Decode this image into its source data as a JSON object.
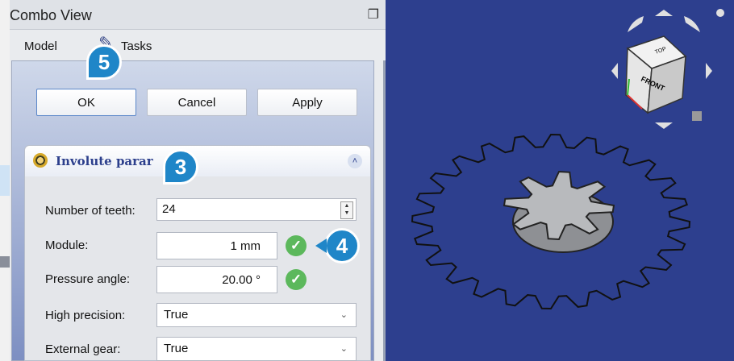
{
  "window": {
    "title": "Combo View"
  },
  "tabs": [
    {
      "label": "Model"
    },
    {
      "label": "Tasks"
    }
  ],
  "buttons": {
    "ok": "OK",
    "cancel": "Cancel",
    "apply": "Apply"
  },
  "section": {
    "title": "Involute parar"
  },
  "fields": {
    "number_of_teeth": {
      "label": "Number of teeth:",
      "value": "24"
    },
    "module": {
      "label": "Module:",
      "value": "1 mm"
    },
    "pressure_angle": {
      "label": "Pressure angle:",
      "value": "20.00 °"
    },
    "high_precision": {
      "label": "High precision:",
      "value": "True"
    },
    "external_gear": {
      "label": "External gear:",
      "value": "True"
    }
  },
  "markers": {
    "m3": "3",
    "m4": "4",
    "m5": "5"
  },
  "navcube": {
    "front_label": "FRONT",
    "top_label": "TOP"
  },
  "colors": {
    "viewport_bg": "#2d3f8e",
    "marker": "#1f86c8",
    "check": "#5cb85c"
  }
}
